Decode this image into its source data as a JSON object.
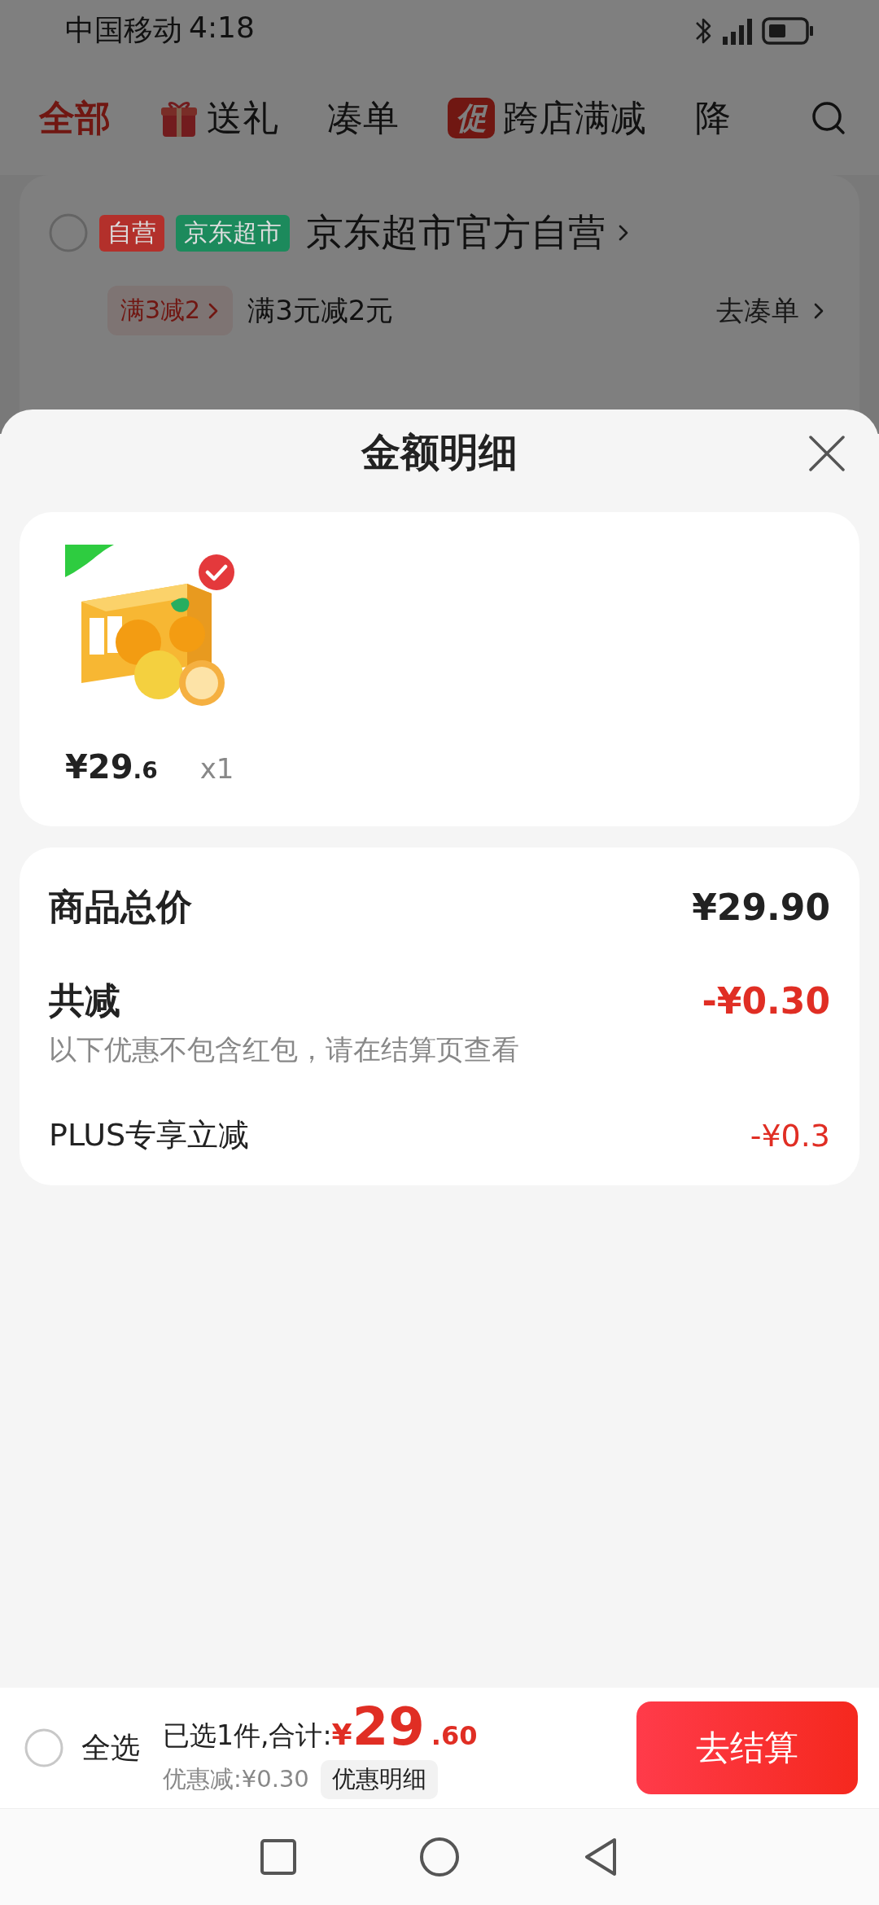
{
  "status_bar": {
    "carrier": "中国移动",
    "time": "4:18"
  },
  "tabs": [
    {
      "label": "全部",
      "selected": true
    },
    {
      "label": "送礼",
      "selected": false,
      "kind": "gift"
    },
    {
      "label": "凑单",
      "selected": false
    },
    {
      "label": "跨店满减",
      "selected": false,
      "kind": "promo",
      "badge": "促"
    },
    {
      "label": "降",
      "selected": false
    }
  ],
  "shop": {
    "checked": false,
    "tags": [
      {
        "label": "自营",
        "color": "#b3302b"
      },
      {
        "label": "京东超市",
        "color": "#1c8a5c"
      }
    ],
    "name": "京东超市官方自营",
    "promo_tag": "满3减2",
    "promo_text": "满3元减2元",
    "promo_link": "去凑单"
  },
  "sheet": {
    "title": "金额明细",
    "items": [
      {
        "kind": "picture",
        "checked": true,
        "price_main": "¥29",
        "price_decimal": ".6",
        "quantity": "x1"
      }
    ],
    "summary": [
      {
        "kind": "total",
        "label": "商品总价",
        "value": "¥29.90"
      },
      {
        "kind": "discount",
        "label": "共减",
        "value": "-¥0.30",
        "note": "以下优惠不包含红包，请在结算页查看"
      },
      {
        "kind": "sub",
        "label": "PLUS专享立减",
        "value": "-¥0.3"
      }
    ]
  },
  "bottom_bar": {
    "select_all": {
      "label": "全选",
      "checked": false
    },
    "selected_text": "已选1件,合计:",
    "currency": "¥",
    "total_main": "29",
    "total_decimal": ".60",
    "discount_text": "优惠减:¥0.30",
    "detail_button": "优惠明细",
    "checkout_button": "去结算"
  }
}
